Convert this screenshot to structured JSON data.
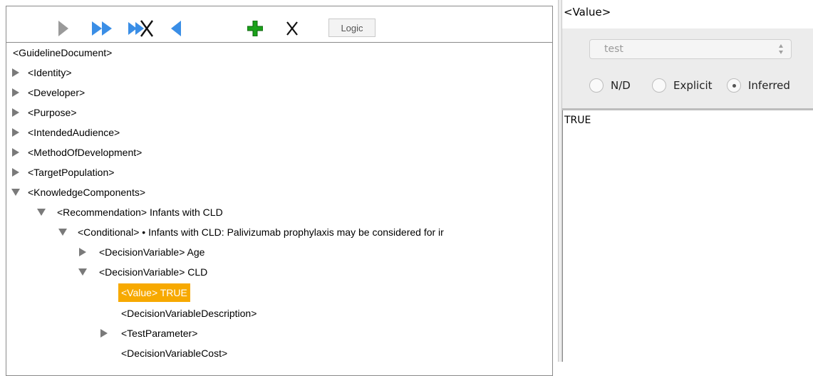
{
  "toolbar": {
    "logic_label": "Logic",
    "icons": [
      "play-icon",
      "fast-forward-icon",
      "fast-forward-cross-icon",
      "back-icon",
      "add-icon",
      "delete-icon"
    ],
    "colors": {
      "play_gray": "#9a9a9a",
      "blue": "#3a8ee6",
      "green": "#1aa11a",
      "black": "#111111"
    }
  },
  "tree": {
    "root": "<GuidelineDocument>",
    "items": [
      {
        "label": "<Identity>",
        "state": "collapsed"
      },
      {
        "label": "<Developer>",
        "state": "collapsed"
      },
      {
        "label": "<Purpose>",
        "state": "collapsed"
      },
      {
        "label": "<IntendedAudience>",
        "state": "collapsed"
      },
      {
        "label": "<MethodOfDevelopment>",
        "state": "collapsed"
      },
      {
        "label": "<TargetPopulation>",
        "state": "collapsed"
      },
      {
        "label": "<KnowledgeComponents>",
        "state": "expanded"
      },
      {
        "label": "<Recommendation> Infants with CLD",
        "state": "expanded"
      },
      {
        "label": "<Conditional> • Infants with CLD: Palivizumab prophylaxis may be considered for ir",
        "state": "expanded"
      },
      {
        "label": "<DecisionVariable> Age",
        "state": "collapsed"
      },
      {
        "label": "<DecisionVariable> CLD",
        "state": "expanded"
      },
      {
        "label": "<Value> TRUE",
        "state": "leaf",
        "selected": true
      },
      {
        "label": "<DecisionVariableDescription>",
        "state": "leaf"
      },
      {
        "label": "<TestParameter>",
        "state": "collapsed"
      },
      {
        "label": "<DecisionVariableCost>",
        "state": "leaf"
      }
    ],
    "selection_color": "#f7a900"
  },
  "right": {
    "title": "<Value>",
    "select_value": "test",
    "radios": [
      {
        "label": "N/D",
        "checked": false
      },
      {
        "label": "Explicit",
        "checked": false
      },
      {
        "label": "Inferred",
        "checked": true
      }
    ],
    "text_value": "TRUE"
  }
}
